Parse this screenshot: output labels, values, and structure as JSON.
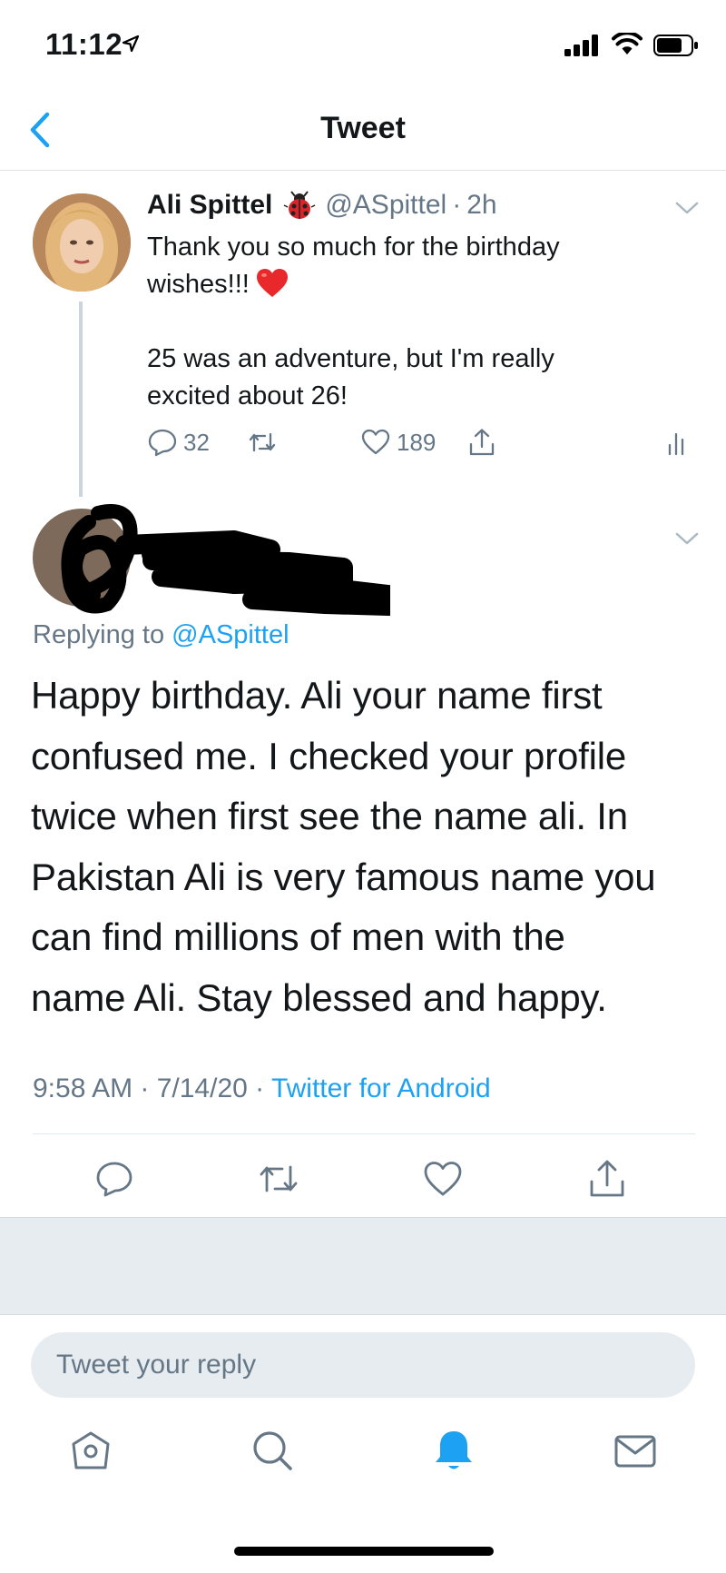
{
  "status_bar": {
    "time": "11:12"
  },
  "nav": {
    "title": "Tweet"
  },
  "parent_tweet": {
    "name": "Ali Spittel",
    "handle": "@ASpittel",
    "separator": "·",
    "time": "2h",
    "text_line1": "Thank you so much for the birthday",
    "text_line2": "wishes!!!",
    "text_line3": "25 was an adventure, but I'm really",
    "text_line4": "excited about 26!",
    "replies": "32",
    "likes": "189"
  },
  "reply_tweet": {
    "replying_prefix": "Replying to ",
    "replying_handle": "@ASpittel",
    "text_lines": [
      "Happy birthday. Ali your name first",
      "confused me. I checked your profile",
      "twice when first see the name ali. In",
      "Pakistan Ali is very famous name you",
      "can find millions of men with the",
      "name Ali.  Stay blessed and happy."
    ],
    "timestamp": "9:58 AM · 7/14/20 · ",
    "source": "Twitter for Android"
  },
  "composer": {
    "placeholder": "Tweet your reply"
  },
  "colors": {
    "accent": "#1da1f2",
    "secondary_text": "#657786",
    "divider": "#e1e8ed",
    "band": "#e6ecf0"
  },
  "icons": {
    "nav": "chevron-left-icon",
    "tabs": [
      "home-icon",
      "search-icon",
      "notifications-bell-icon",
      "messages-envelope-icon"
    ]
  }
}
